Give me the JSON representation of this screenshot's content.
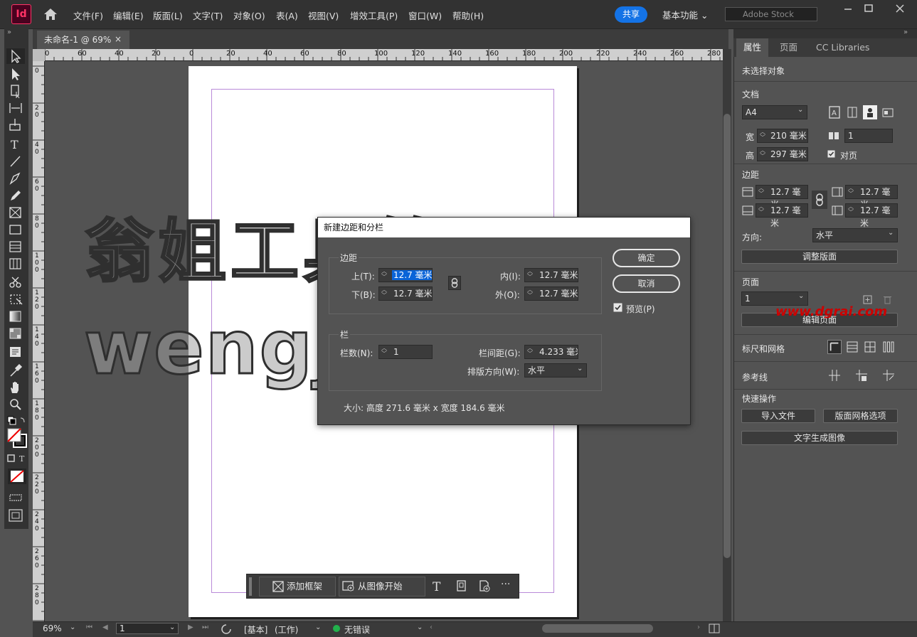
{
  "app": {
    "logo": "Id",
    "menu": [
      "文件(F)",
      "编辑(E)",
      "版面(L)",
      "文字(T)",
      "对象(O)",
      "表(A)",
      "视图(V)",
      "增效工具(P)",
      "窗口(W)",
      "帮助(H)"
    ],
    "share": "共享",
    "workspace": "基本功能",
    "stock_placeholder": "Adobe Stock"
  },
  "document": {
    "tab_title": "未命名-1 @ 69%",
    "close_symbol": "×"
  },
  "rulers": {
    "horizontal": [
      "0",
      "60",
      "40",
      "20",
      "0",
      "20",
      "40",
      "60",
      "80",
      "100",
      "120",
      "140",
      "160",
      "180",
      "200",
      "220",
      "240",
      "260",
      "280"
    ],
    "vertical": [
      "0",
      "20",
      "40",
      "60",
      "80",
      "100",
      "120",
      "140",
      "160",
      "180",
      "200",
      "220",
      "240",
      "260",
      "280"
    ]
  },
  "dialog": {
    "title": "新建边距和分栏",
    "margins_group": "边距",
    "top_label": "上(T):",
    "top_value": "12.7 毫米",
    "bottom_label": "下(B):",
    "bottom_value": "12.7 毫米",
    "inside_label": "内(I):",
    "inside_value": "12.7 毫米",
    "outside_label": "外(O):",
    "outside_value": "12.7 毫米",
    "columns_group": "栏",
    "count_label": "栏数(N):",
    "count_value": "1",
    "gutter_label": "栏间距(G):",
    "gutter_value": "4.233 毫米",
    "direction_label": "排版方向(W):",
    "direction_value": "水平",
    "size_text": "大小: 高度 271.6 毫米 x 宽度 184.6 毫米",
    "ok": "确定",
    "cancel": "取消",
    "preview": "预览(P)"
  },
  "panel": {
    "tabs": [
      "属性",
      "页面",
      "CC Libraries"
    ],
    "no_selection": "未选择对象",
    "doc_section": "文档",
    "page_size": "A4",
    "width_label": "宽",
    "width_value": "210 毫米",
    "height_label": "高",
    "height_value": "297 毫米",
    "pages_value": "1",
    "facing_pages": "对页",
    "margins_section": "边距",
    "margin_top": "12.7 毫米",
    "margin_bottom": "12.7 毫米",
    "margin_inside": "12.7 毫米",
    "margin_outside": "12.7 毫米",
    "orientation_label": "方向:",
    "orientation_value": "水平",
    "adjust_layout": "调整版面",
    "pages_section": "页面",
    "page_select": "1",
    "edit_page": "编辑页面",
    "rulers_grids": "标尺和网格",
    "guides": "参考线",
    "quick_actions": "快速操作",
    "import_file": "导入文件",
    "layout_grid": "版面网格选项",
    "text_to_image": "文字生成图像"
  },
  "taskbar": {
    "add_frame": "添加框架",
    "from_image": "从图像开始",
    "more": "···"
  },
  "status": {
    "zoom": "69%",
    "page": "1",
    "style": "[基本]",
    "mode": "(工作)",
    "errors": "无错误"
  },
  "watermark": {
    "line1": "翁姐工具箱",
    "line2": "wengjie.com",
    "url": "www.dgrai.com"
  },
  "colors": {
    "accent": "#1473e6",
    "logo": "#ff3366",
    "margin_guide": "#b98ad8",
    "status_ok": "#22b14c"
  }
}
